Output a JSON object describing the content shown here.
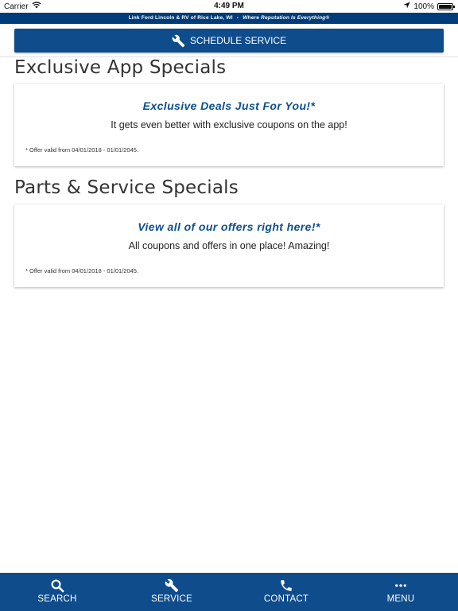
{
  "status_bar": {
    "carrier": "Carrier",
    "time": "4:49 PM",
    "battery": "100%",
    "battery_level": 1.0
  },
  "dealer_banner": {
    "name": "Link Ford Lincoln & RV of Rice Lake, WI",
    "separator": "-",
    "slogan": "Where Reputation Is Everything®"
  },
  "schedule_button": {
    "label": "SCHEDULE SERVICE",
    "icon": "wrench-icon"
  },
  "sections": [
    {
      "title": "Exclusive App Specials",
      "card": {
        "headline": "Exclusive Deals Just For You!*",
        "body": "It gets even better with exclusive coupons on the app!",
        "disclaimer": "*  Offer valid from 04/01/2018 - 01/01/2045."
      }
    },
    {
      "title": "Parts & Service Specials",
      "card": {
        "headline": "View all of our offers right here!*",
        "body": "All coupons and offers in one place! Amazing!",
        "disclaimer": "*  Offer valid from 04/01/2018 - 01/01/2045."
      }
    }
  ],
  "bottom_nav": [
    {
      "label": "SEARCH",
      "icon": "search-icon"
    },
    {
      "label": "SERVICE",
      "icon": "wrench-icon"
    },
    {
      "label": "CONTACT",
      "icon": "phone-icon"
    },
    {
      "label": "MENU",
      "icon": "more-dots-icon"
    }
  ],
  "colors": {
    "brand_blue": "#0f4c8c",
    "banner_blue": "#003b7a",
    "headline_blue": "#0d4f8b"
  }
}
